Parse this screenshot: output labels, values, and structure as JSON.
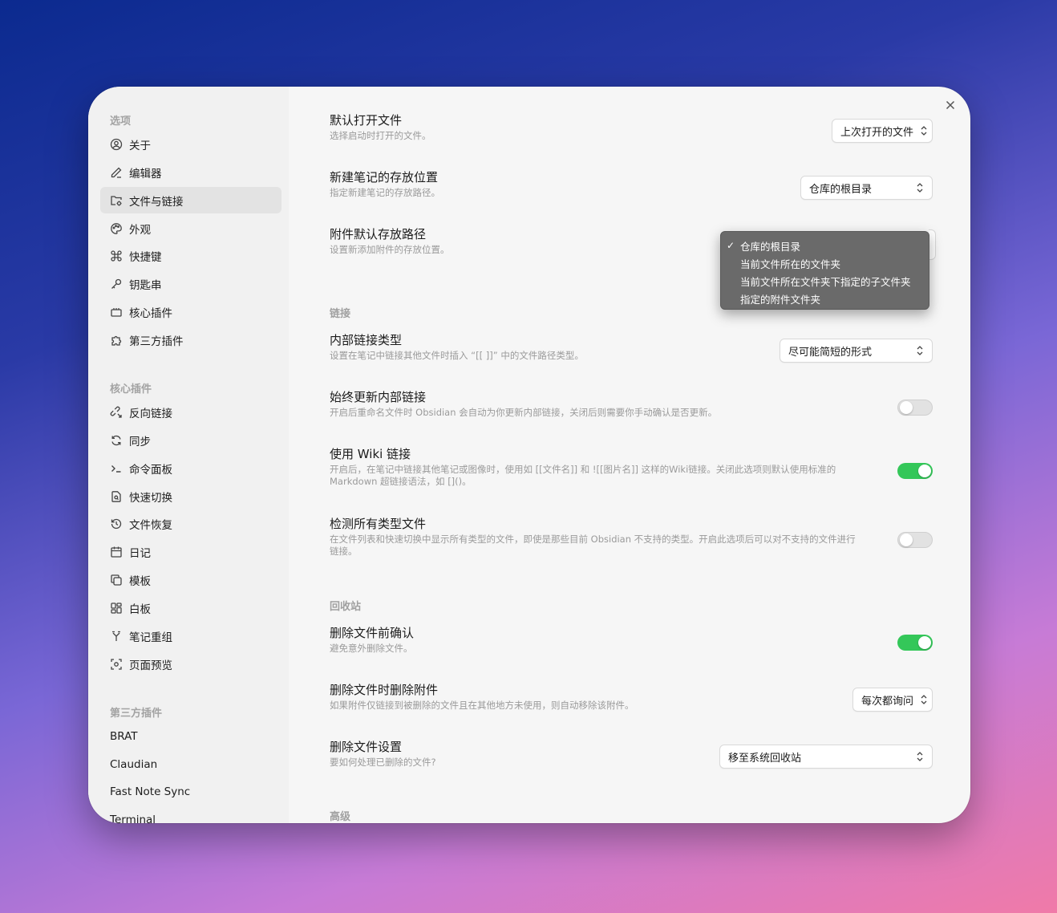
{
  "sidebar": {
    "options_heading": "选项",
    "options": [
      {
        "label": "关于",
        "icon": "user-circle-icon"
      },
      {
        "label": "编辑器",
        "icon": "pen-icon"
      },
      {
        "label": "文件与链接",
        "icon": "folder-cog-icon",
        "active": true
      },
      {
        "label": "外观",
        "icon": "palette-icon"
      },
      {
        "label": "快捷键",
        "icon": "command-icon"
      },
      {
        "label": "钥匙串",
        "icon": "key-icon"
      },
      {
        "label": "核心插件",
        "icon": "plugin-box-icon"
      },
      {
        "label": "第三方插件",
        "icon": "puzzle-icon"
      }
    ],
    "core_heading": "核心插件",
    "core": [
      {
        "label": "反向链接",
        "icon": "backlink-icon"
      },
      {
        "label": "同步",
        "icon": "sync-icon"
      },
      {
        "label": "命令面板",
        "icon": "terminal-icon"
      },
      {
        "label": "快速切换",
        "icon": "file-search-icon"
      },
      {
        "label": "文件恢复",
        "icon": "history-icon"
      },
      {
        "label": "日记",
        "icon": "calendar-icon"
      },
      {
        "label": "模板",
        "icon": "copy-icon"
      },
      {
        "label": "白板",
        "icon": "layout-icon"
      },
      {
        "label": "笔记重组",
        "icon": "merge-icon"
      },
      {
        "label": "页面预览",
        "icon": "preview-icon"
      }
    ],
    "third_heading": "第三方插件",
    "third": [
      "BRAT",
      "Claudian",
      "Fast Note Sync",
      "Terminal"
    ]
  },
  "settings": {
    "default_open": {
      "name": "默认打开文件",
      "desc": "选择启动时打开的文件。",
      "value": "上次打开的文件"
    },
    "new_note": {
      "name": "新建笔记的存放位置",
      "desc": "指定新建笔记的存放路径。",
      "value": "仓库的根目录"
    },
    "attachment": {
      "name": "附件默认存放路径",
      "desc": "设置新添加附件的存放位置。"
    },
    "links_heading": "链接",
    "link_type": {
      "name": "内部链接类型",
      "desc": "设置在笔记中链接其他文件时插入 “[[ ]]” 中的文件路径类型。",
      "value": "尽可能简短的形式"
    },
    "update_links": {
      "name": "始终更新内部链接",
      "desc": "开启后重命名文件时 Obsidian 会自动为你更新内部链接，关闭后则需要你手动确认是否更新。",
      "on": false
    },
    "wiki_links": {
      "name": "使用 Wiki 链接",
      "desc1": "开启后，在笔记中链接其他笔记或图像时，使用如 [[文件名]] 和 ![[图片名]] 这样的Wiki链接。关闭此选项则默认使用标准的",
      "desc2": "Markdown 超链接语法，如 []()。",
      "on": true
    },
    "detect_all": {
      "name": "检测所有类型文件",
      "desc1": "在文件列表和快速切换中显示所有类型的文件，即使是那些目前 Obsidian 不支持的类型。开启此选项后可以对不支持的文件进行",
      "desc2": "链接。",
      "on": false
    },
    "trash_heading": "回收站",
    "confirm_delete": {
      "name": "删除文件前确认",
      "desc": "避免意外删除文件。",
      "on": true
    },
    "delete_attach": {
      "name": "删除文件时删除附件",
      "desc": "如果附件仅链接到被删除的文件且在其他地方未使用，则自动移除该附件。",
      "value": "每次都询问"
    },
    "delete_setting": {
      "name": "删除文件设置",
      "desc": "要如何处理已删除的文件?",
      "value": "移至系统回收站"
    },
    "advanced_heading": "高级"
  },
  "dropdown": {
    "items": [
      "仓库的根目录",
      "当前文件所在的文件夹",
      "当前文件所在文件夹下指定的子文件夹",
      "指定的附件文件夹"
    ],
    "selected_index": 0,
    "check": "✓"
  },
  "colors": {
    "toggle_on": "#34c759",
    "popup_bg": "#6a6a6a"
  }
}
